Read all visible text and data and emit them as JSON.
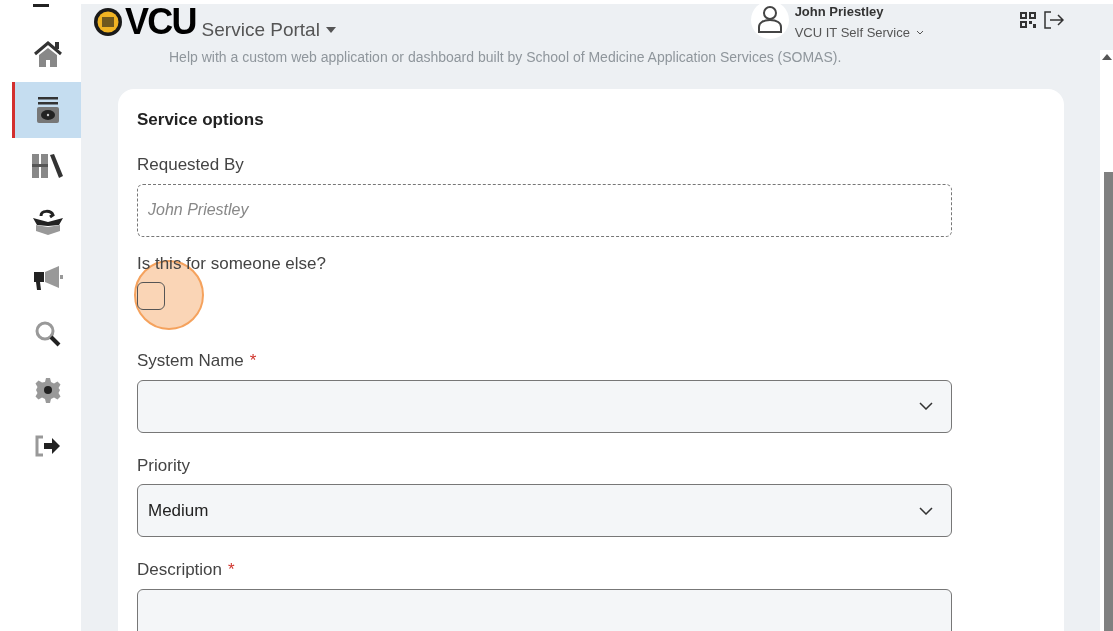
{
  "header": {
    "logo": "VCU",
    "portal_menu": "Service Portal",
    "user": {
      "name": "John Priestley",
      "org": "VCU IT Self Service"
    }
  },
  "sidebar": {
    "items": [
      {
        "selected": false
      },
      {
        "selected": true
      },
      {
        "selected": false
      },
      {
        "selected": false
      },
      {
        "selected": false
      },
      {
        "selected": false
      },
      {
        "selected": false
      },
      {
        "selected": false
      }
    ]
  },
  "intro": "Help with a custom web application or dashboard built by School of Medicine Application Services (SOMAS).",
  "form": {
    "title": "Service options",
    "fields": [
      {
        "kind": "readonly",
        "label": "Requested By",
        "placeholder": "John Priestley"
      },
      {
        "kind": "checkbox",
        "label": "Is this for someone else?",
        "checked": false,
        "highlighted": true
      },
      {
        "kind": "select",
        "label": "System Name",
        "required_mark": "*"
      },
      {
        "kind": "select",
        "label": "Priority",
        "value": "Medium"
      },
      {
        "kind": "textarea",
        "label": "Description",
        "required_mark": "*"
      }
    ]
  }
}
